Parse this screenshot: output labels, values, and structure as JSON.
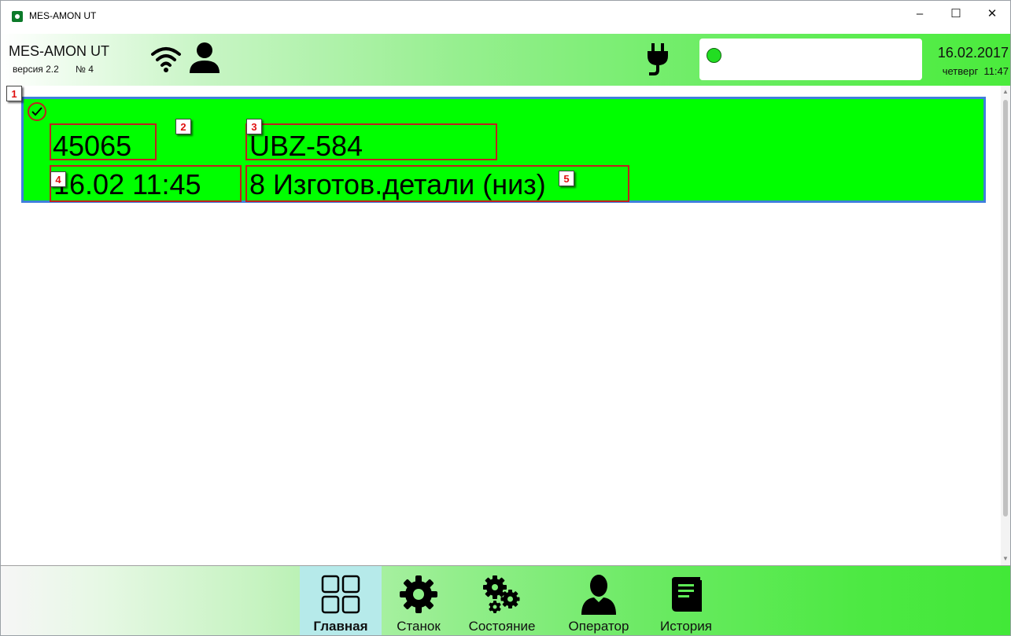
{
  "window": {
    "title": "MES-AMON UT",
    "controls": {
      "minimize": "–",
      "maximize": "☐",
      "close": "✕"
    }
  },
  "header": {
    "app_name": "MES-AMON UT",
    "version": "версия 2.2",
    "number": "№ 4",
    "date": "16.02.2017",
    "weekday_time": "четверг  11:47",
    "status_color": "#22dd22"
  },
  "order": {
    "order_number": "45065",
    "part_code": "UBZ-584",
    "datetime": "16.02 11:45",
    "operation": "8 Изготов.детали (низ)",
    "background_color": "#00ff00",
    "border_color": "#3f7fdc"
  },
  "callouts": [
    "1",
    "2",
    "3",
    "4",
    "5"
  ],
  "nav": [
    {
      "label": "Главная",
      "icon": "home-grid-icon",
      "active": true
    },
    {
      "label": "Станок",
      "icon": "gear-icon",
      "active": false
    },
    {
      "label": "Состояние",
      "icon": "gears-icon",
      "active": false
    },
    {
      "label": "Оператор",
      "icon": "operator-icon",
      "active": false
    },
    {
      "label": "История",
      "icon": "book-icon",
      "active": false
    }
  ]
}
